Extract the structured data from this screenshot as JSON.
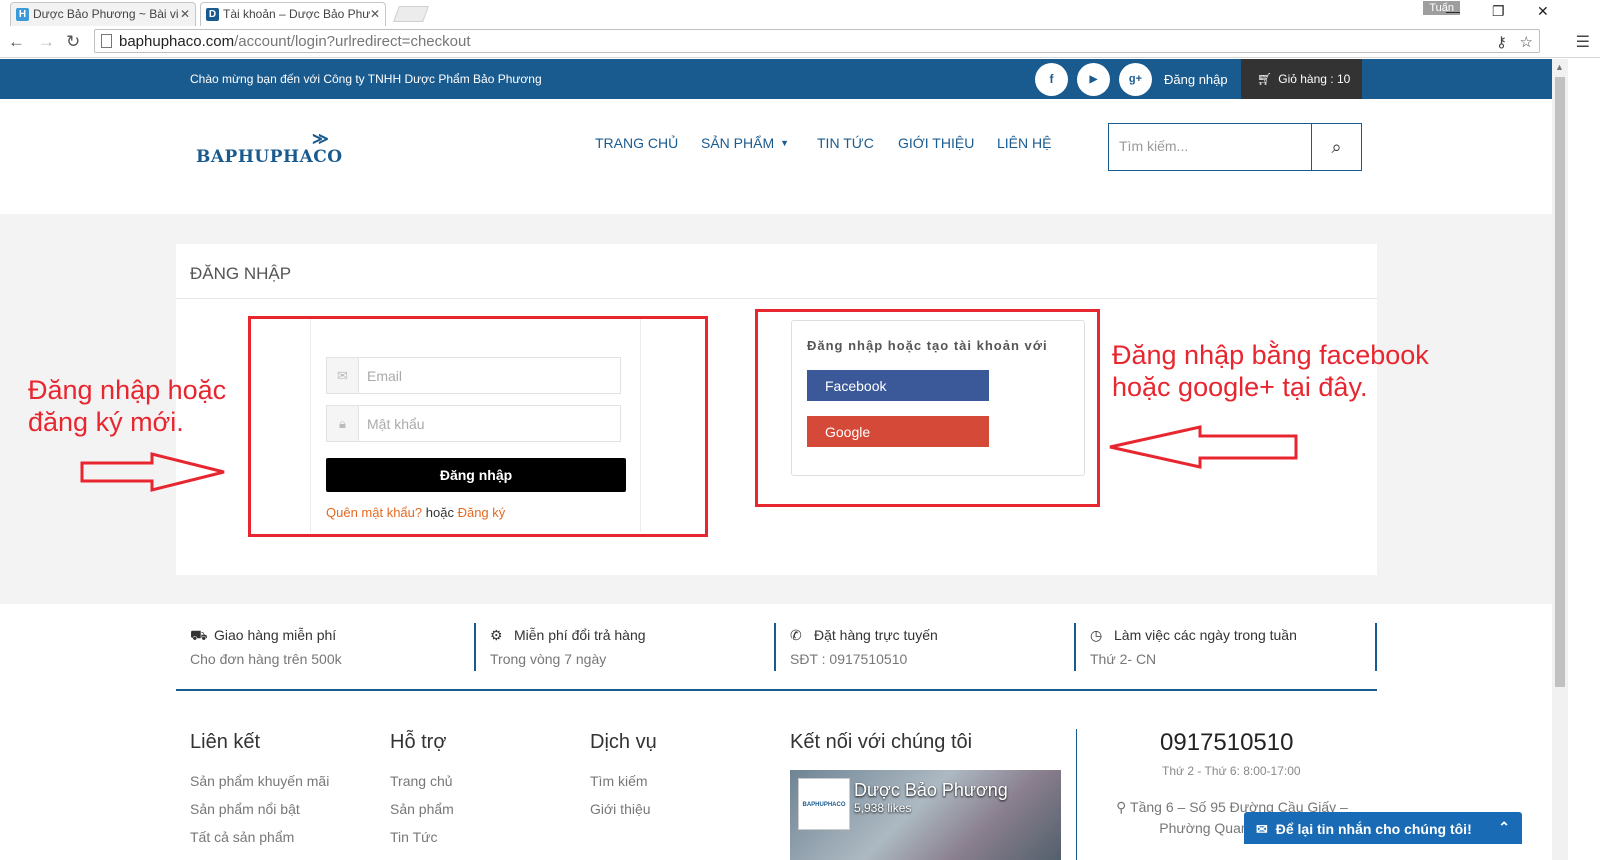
{
  "browser": {
    "tabs": [
      {
        "title": "Dược Bảo Phương ~ Bài vi",
        "favicon": "H"
      },
      {
        "title": "Tài khoản – Dược Bảo Phư",
        "favicon": "D"
      }
    ],
    "user": "Tuấn",
    "url_main": "baphuphaco.com",
    "url_path": "/account/login?urlredirect=checkout"
  },
  "topbar": {
    "welcome": "Chào mừng bạn đến với Công ty TNHH Dược Phẩm Bảo Phương",
    "social": [
      "f",
      "▶",
      "g+"
    ],
    "login": "Đăng nhập",
    "cart": "Giỏ hàng : 10"
  },
  "header": {
    "logo": "BAPHUPHACO",
    "nav": [
      "TRANG CHỦ",
      "SẢN PHẨM",
      "TIN TỨC",
      "GIỚI THIỆU",
      "LIÊN HỆ"
    ],
    "search_placeholder": "Tìm kiếm..."
  },
  "login": {
    "heading": "ĐĂNG NHẬP",
    "email_placeholder": "Email",
    "password_placeholder": "Mật khẩu",
    "submit": "Đăng nhập",
    "forgot": "Quên mật khẩu?",
    "or": "hoặc",
    "register": "Đăng ký"
  },
  "social_login": {
    "title": "Đăng nhập hoặc tạo tài khoản với",
    "facebook": "Facebook",
    "google": "Google"
  },
  "annotations": {
    "left_line1": "Đăng nhập hoặc",
    "left_line2": "đăng ký mới.",
    "right_line1": "Đăng nhập bằng facebook",
    "right_line2": "hoặc google+ tại đây."
  },
  "features": [
    {
      "title": "Giao hàng miễn phí",
      "sub": "Cho đơn hàng trên 500k",
      "icon": "truck-icon"
    },
    {
      "title": "Miễn phí đổi trả hàng",
      "sub": "Trong vòng 7 ngày",
      "icon": "gear-icon"
    },
    {
      "title": "Đặt hàng trực tuyến",
      "sub": "SĐT : 0917510510",
      "icon": "phone-icon"
    },
    {
      "title": "Làm việc các ngày trong tuần",
      "sub": "Thứ 2- CN",
      "icon": "clock-icon"
    }
  ],
  "footer": {
    "cols": [
      {
        "title": "Liên kết",
        "links": [
          "Sản phẩm khuyến mãi",
          "Sản phẩm nổi bật",
          "Tất cả sản phẩm"
        ]
      },
      {
        "title": "Hỗ trợ",
        "links": [
          "Trang chủ",
          "Sản phẩm",
          "Tin Tức"
        ]
      },
      {
        "title": "Dịch vụ",
        "links": [
          "Tìm kiếm",
          "Giới thiệu"
        ]
      },
      {
        "title": "Kết nối với chúng tôi",
        "links": []
      }
    ],
    "fb_page": "Dược Bảo Phương",
    "fb_likes": "5,938 likes",
    "fb_pic": "BAPHUPHACO",
    "phone": "0917510510",
    "hours": "Thứ 2 - Thứ 6: 8:00-17:00",
    "address": "Tầng 6 – Số 95 Đường Cầu Giấy – Phường Quan Hoa – Q",
    "chat": "Để lại tin nhắn cho chúng tôi!"
  },
  "colors": {
    "brand": "#1a5b8f",
    "annotation": "#e8262f",
    "facebook": "#3b5998",
    "google": "#d44937"
  }
}
